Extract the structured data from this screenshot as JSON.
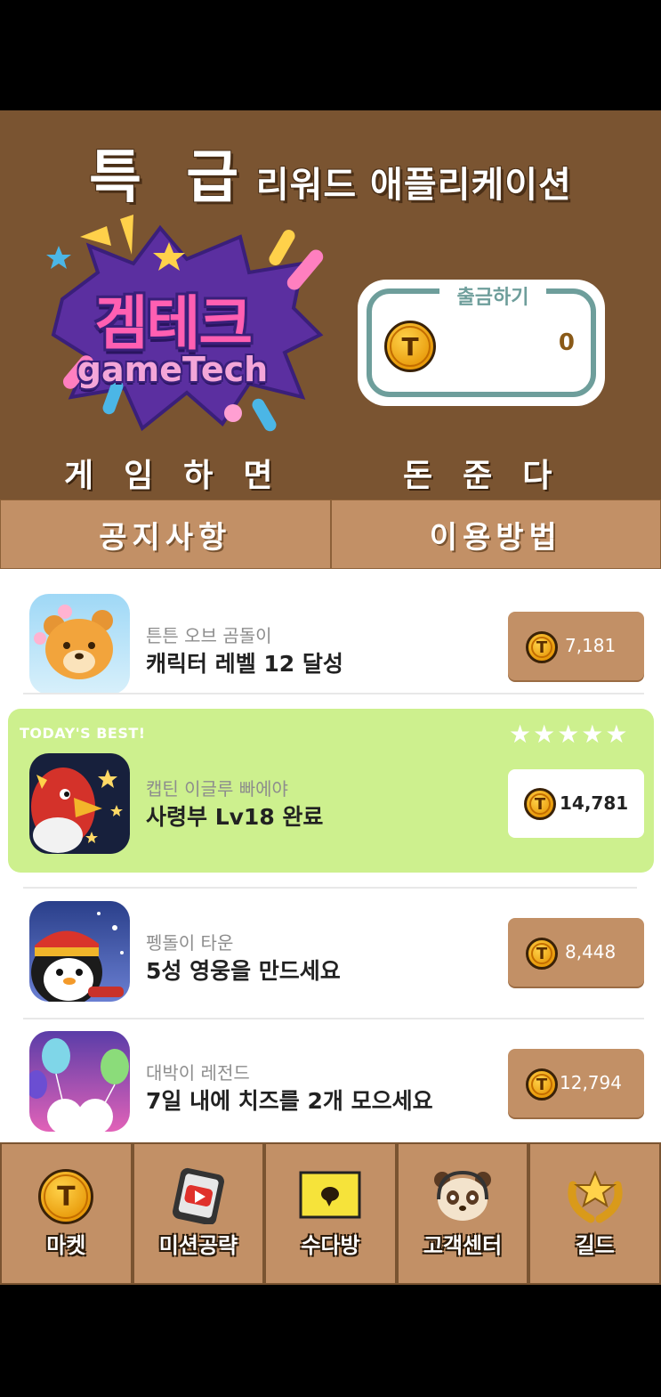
{
  "header": {
    "title_big": "특 급",
    "title_rest": "리워드 애플리케이션",
    "logo_ko": "겜테크",
    "logo_en": "gameTech",
    "slogan_left": "게임하면",
    "slogan_right": "돈준다"
  },
  "withdraw": {
    "label": "출금하기",
    "coin_symbol": "T",
    "amount": "0"
  },
  "tabs": [
    {
      "label": "공지사항"
    },
    {
      "label": "이용방법"
    }
  ],
  "missions": [
    {
      "game": "튼튼 오브 곰돌이",
      "mission": "캐릭터 레벨 12 달성",
      "reward": "7,181",
      "icon": "bear-game-icon"
    },
    {
      "game": "캡틴 이글루 빠에야",
      "mission": "사령부 Lv18 완료",
      "reward": "14,781",
      "icon": "eagle-game-icon",
      "best": true
    },
    {
      "game": "펭돌이 타운",
      "mission": "5성 영웅을 만드세요",
      "reward": "8,448",
      "icon": "penguin-game-icon"
    },
    {
      "game": "대박이 레전드",
      "mission": "7일 내에 치즈를 2개 모으세요",
      "reward": "12,794",
      "icon": "balloon-game-icon"
    }
  ],
  "best_badge": "TODAY'S BEST!",
  "best_stars": "★★★★★",
  "nav": [
    {
      "label": "마켓",
      "icon": "coin-icon"
    },
    {
      "label": "미션공략",
      "icon": "video-phone-icon"
    },
    {
      "label": "수다방",
      "icon": "chat-bubble-icon"
    },
    {
      "label": "고객센터",
      "icon": "headset-panda-icon"
    },
    {
      "label": "길드",
      "icon": "guild-laurel-icon"
    }
  ],
  "colors": {
    "header_bg": "#7a5431",
    "tab_bg": "#c29066",
    "best_bg": "#cdf08e",
    "withdraw_border": "#6e9e9b"
  }
}
